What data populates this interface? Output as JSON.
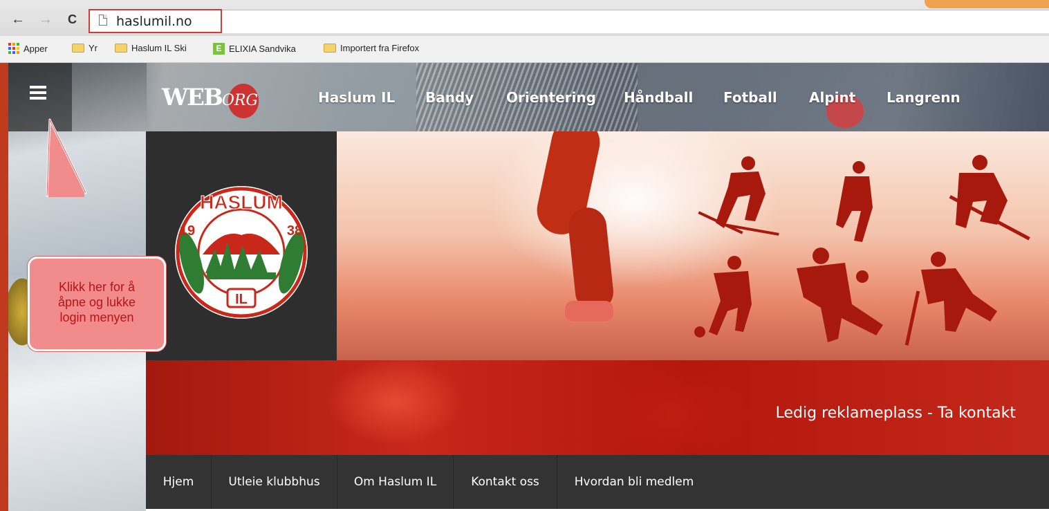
{
  "browser": {
    "back_icon": "arrow-left-icon",
    "forward_icon": "arrow-right-icon",
    "reload_icon": "reload-icon",
    "url": "haslumil.no"
  },
  "bookmarks": [
    {
      "label": "Apper",
      "icon": "apps-grid-icon"
    },
    {
      "label": "Yr",
      "icon": "folder-icon"
    },
    {
      "label": "Haslum IL Ski",
      "icon": "folder-icon"
    },
    {
      "label": "ELIXIA Sandvika",
      "icon": "elixia-icon"
    },
    {
      "label": "Importert fra Firefox",
      "icon": "folder-icon"
    }
  ],
  "header": {
    "menu_icon": "hamburger-icon",
    "logo_text": "WEB",
    "logo_text_small": "ORG",
    "sports": [
      "Haslum IL",
      "Bandy",
      "Orientering",
      "Håndball",
      "Fotball",
      "Alpint",
      "Langrenn"
    ]
  },
  "club_logo": {
    "top_text": "HASLUM",
    "year_left": "19",
    "year_right": "38",
    "bottom_text": "IL"
  },
  "ad_banner": {
    "text": "Ledig reklameplass - Ta kontakt"
  },
  "main_nav": [
    "Hjem",
    "Utleie klubbhus",
    "Om Haslum IL",
    "Kontakt oss",
    "Hvordan bli medlem"
  ],
  "callout": {
    "line1": "Klikk her for å",
    "line2": "åpne og lukke",
    "line3": "login menyen"
  },
  "colors": {
    "accent_red": "#c8271a",
    "nav_dark": "#333333",
    "callout_fill": "#f28b8b",
    "callout_text": "#b81414"
  }
}
